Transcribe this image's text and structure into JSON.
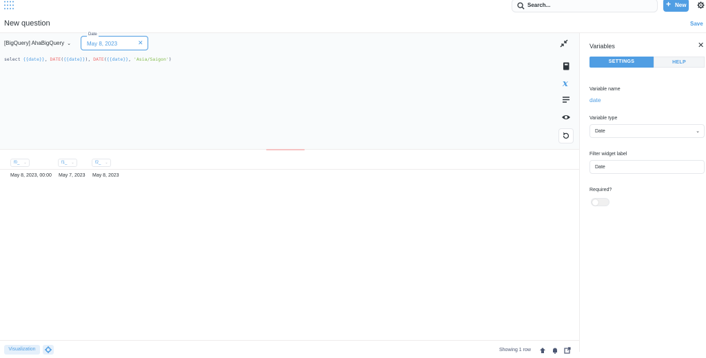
{
  "topbar": {
    "search_placeholder": "Search...",
    "new_label": "New",
    "accent_color": "#509ee3"
  },
  "question": {
    "title": "New question",
    "save_label": "Save"
  },
  "editor": {
    "database": "[BigQuery] AhaBigQuery",
    "date_filter": {
      "label": "Date",
      "value": "May 8, 2023"
    },
    "sql": {
      "p1": "select ",
      "v1": "{{date}}",
      "p2": ", ",
      "f1": "DATE",
      "p3": "(",
      "v2": "{{date}}",
      "p4": "), ",
      "f2": "DATE",
      "p5": "(",
      "v3": "{{date}}",
      "p6": ", ",
      "s1": "'Asia/Saigon'",
      "p7": ")"
    }
  },
  "results": {
    "columns": [
      "f0_",
      "f1_",
      "f2_"
    ],
    "row": [
      "May 8, 2023, 00:00",
      "May 7, 2023",
      "May 8, 2023"
    ]
  },
  "footer": {
    "visualization_label": "Visualization",
    "row_count": "Showing 1 row"
  },
  "variables_panel": {
    "title": "Variables",
    "tabs": [
      "SETTINGS",
      "HELP"
    ],
    "variable_name_label": "Variable name",
    "variable_name": "date",
    "variable_type_label": "Variable type",
    "variable_type": "Date",
    "widget_label_label": "Filter widget label",
    "widget_label": "Date",
    "required_label": "Required?",
    "required": false
  }
}
